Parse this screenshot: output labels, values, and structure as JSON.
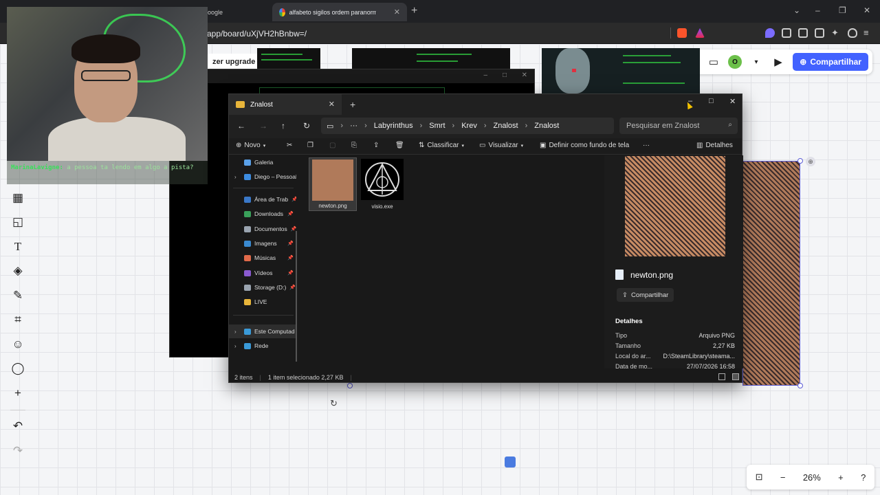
{
  "browser": {
    "tabs": [
      {
        "title": "oogle"
      },
      {
        "title": "alfabeto sigilos ordem paranormal - Pesquis"
      }
    ],
    "new_tab_icon": "plus-icon",
    "url": "app/board/uXjVH2hBnbw=/",
    "window_controls": [
      "⌄",
      "–",
      "❐",
      "✕"
    ]
  },
  "board": {
    "upgrade_label": "zer upgrade",
    "share_label": "Compartilhar",
    "avatar_initial": "O",
    "zoom": "26%",
    "accent": "#4262ff"
  },
  "stream_chat": {
    "user": "MarinaLavigne:",
    "message": "a pessoa ta lendo em algo a pista?"
  },
  "explorer": {
    "tab_title": "Znalost",
    "breadcrumb": [
      "Labyrinthus",
      "Smrt",
      "Krev",
      "Znalost",
      "Znalost"
    ],
    "search_placeholder": "Pesquisar em Znalost",
    "commands": {
      "new": "Novo",
      "sort": "Classificar",
      "view": "Visualizar",
      "set_background": "Definir como fundo de tela",
      "more": "···",
      "details": "Detalhes"
    },
    "sidebar": [
      {
        "label": "Galeria",
        "color": "#5aa0e8",
        "pin": false,
        "arrow": false
      },
      {
        "label": "Diego – Pessoal",
        "color": "#3d8ce0",
        "pin": false,
        "arrow": true
      },
      {
        "label": "Área de Trab",
        "color": "#3a78c8",
        "pin": true,
        "arrow": false
      },
      {
        "label": "Downloads",
        "color": "#3aa05a",
        "pin": true,
        "arrow": false
      },
      {
        "label": "Documentos",
        "color": "#9aa4b0",
        "pin": true,
        "arrow": false
      },
      {
        "label": "Imagens",
        "color": "#3a8ad0",
        "pin": true,
        "arrow": false
      },
      {
        "label": "Músicas",
        "color": "#e06a4a",
        "pin": true,
        "arrow": false
      },
      {
        "label": "Vídeos",
        "color": "#8a5ad0",
        "pin": true,
        "arrow": false
      },
      {
        "label": "Storage (D:)",
        "color": "#9aa4b0",
        "pin": true,
        "arrow": false
      },
      {
        "label": "LIVE",
        "color": "#e8b53a",
        "pin": false,
        "arrow": false
      },
      {
        "label": "Este Computad",
        "color": "#3a9ad8",
        "pin": false,
        "arrow": true
      },
      {
        "label": "Rede",
        "color": "#3a9ad8",
        "pin": false,
        "arrow": true
      }
    ],
    "files": [
      {
        "name": "newton.png",
        "selected": true
      },
      {
        "name": "visio.exe",
        "selected": false
      }
    ],
    "details": {
      "file_name": "newton.png",
      "share_label": "Compartilhar",
      "heading": "Detalhes",
      "rows": [
        {
          "label": "Tipo",
          "value": "Arquivo PNG"
        },
        {
          "label": "Tamanho",
          "value": "2,27 KB"
        },
        {
          "label": "Local do ar...",
          "value": "D:\\SteamLibrary\\steama..."
        },
        {
          "label": "Data de mo...",
          "value": "27/07/2026 16:58"
        }
      ]
    },
    "status": {
      "count": "2 itens",
      "selection": "1 item selecionado  2,27 KB"
    }
  }
}
